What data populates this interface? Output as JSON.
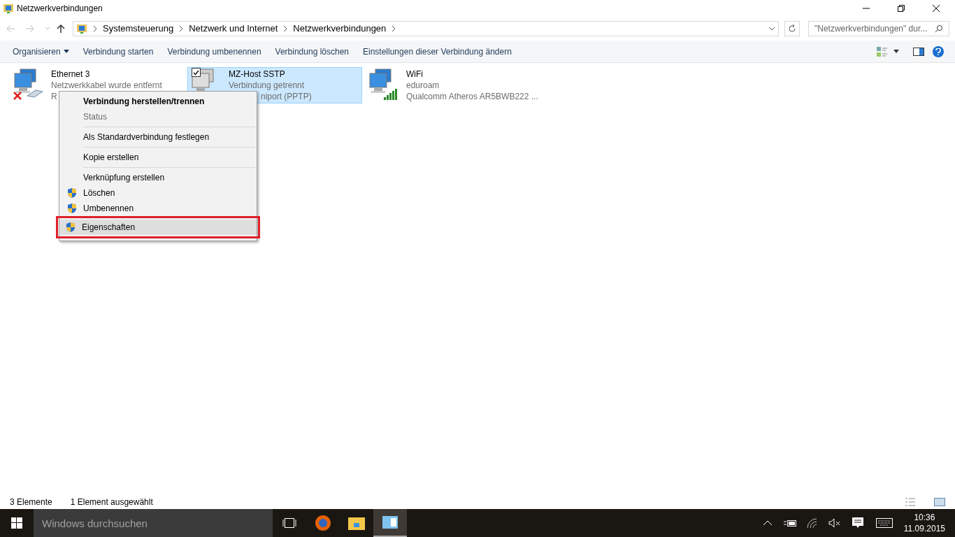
{
  "window": {
    "title": "Netzwerkverbindungen"
  },
  "address": {
    "crumbs": [
      "Systemsteuerung",
      "Netzwerk und Internet",
      "Netzwerkverbindungen"
    ]
  },
  "search": {
    "placeholder": "\"Netzwerkverbindungen\" dur..."
  },
  "toolbar": [
    {
      "label": "Organisieren",
      "dropdown": true
    },
    {
      "label": "Verbindung starten",
      "dropdown": false
    },
    {
      "label": "Verbindung umbenennen",
      "dropdown": false
    },
    {
      "label": "Verbindung löschen",
      "dropdown": false
    },
    {
      "label": "Einstellungen dieser Verbindung ändern",
      "dropdown": false
    }
  ],
  "connections": [
    {
      "kind": "ethernet",
      "name": "Ethernet 3",
      "line2": "Netzwerkkabel wurde entfernt",
      "line3": "R",
      "selected": false
    },
    {
      "kind": "vpn",
      "name": "MZ-Host SSTP",
      "line2": "Verbindung getrennt",
      "line3": "niport (PPTP)",
      "selected": true
    },
    {
      "kind": "wifi",
      "name": "WiFi",
      "line2": "eduroam",
      "line3": "Qualcomm Atheros AR5BWB222 ...",
      "selected": false
    }
  ],
  "context_menu": {
    "items": [
      {
        "label": "Verbindung herstellen/trennen",
        "bold": true,
        "disabled": false,
        "shield": false,
        "highlighted": false,
        "separator_after": false
      },
      {
        "label": "Status",
        "bold": false,
        "disabled": true,
        "shield": false,
        "highlighted": false,
        "separator_after": true
      },
      {
        "label": "Als Standardverbindung festlegen",
        "bold": false,
        "disabled": false,
        "shield": false,
        "highlighted": false,
        "separator_after": true
      },
      {
        "label": "Kopie erstellen",
        "bold": false,
        "disabled": false,
        "shield": false,
        "highlighted": false,
        "separator_after": true
      },
      {
        "label": "Verknüpfung erstellen",
        "bold": false,
        "disabled": false,
        "shield": false,
        "highlighted": false,
        "separator_after": false
      },
      {
        "label": "Löschen",
        "bold": false,
        "disabled": false,
        "shield": true,
        "highlighted": false,
        "separator_after": false
      },
      {
        "label": "Umbenennen",
        "bold": false,
        "disabled": false,
        "shield": true,
        "highlighted": false,
        "separator_after": false
      },
      {
        "label": "Eigenschaften",
        "bold": false,
        "disabled": false,
        "shield": true,
        "highlighted": true,
        "separator_after": false
      }
    ]
  },
  "status_bar": {
    "count": "3 Elemente",
    "selection": "1 Element ausgewählt"
  },
  "taskbar": {
    "search_placeholder": "Windows durchsuchen",
    "time": "10:36",
    "date": "11.09.2015"
  }
}
